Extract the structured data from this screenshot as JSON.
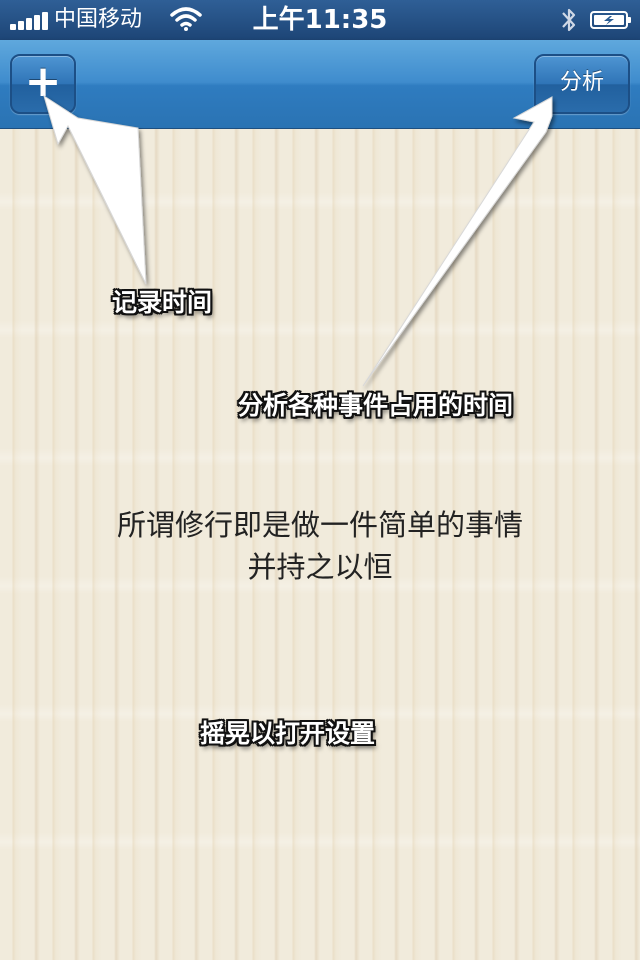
{
  "status_bar": {
    "carrier": "中国移动",
    "time": "上午11:35",
    "signal_bars": 5,
    "icons": [
      "signal-icon",
      "wifi-icon",
      "bluetooth-icon",
      "battery-charging-icon"
    ]
  },
  "nav": {
    "add_label": "+",
    "analyze_label": "分析"
  },
  "hints": {
    "record": "记录时间",
    "analyze": "分析各种事件占用的时间",
    "shake": "摇晃以打开设置"
  },
  "motto": {
    "line1": "所谓修行即是做一件简单的事情",
    "line2": "并持之以恒"
  },
  "colors": {
    "nav_blue": "#3f8ccd",
    "background": "#f1ebdc",
    "hint_text": "#ffffff"
  }
}
